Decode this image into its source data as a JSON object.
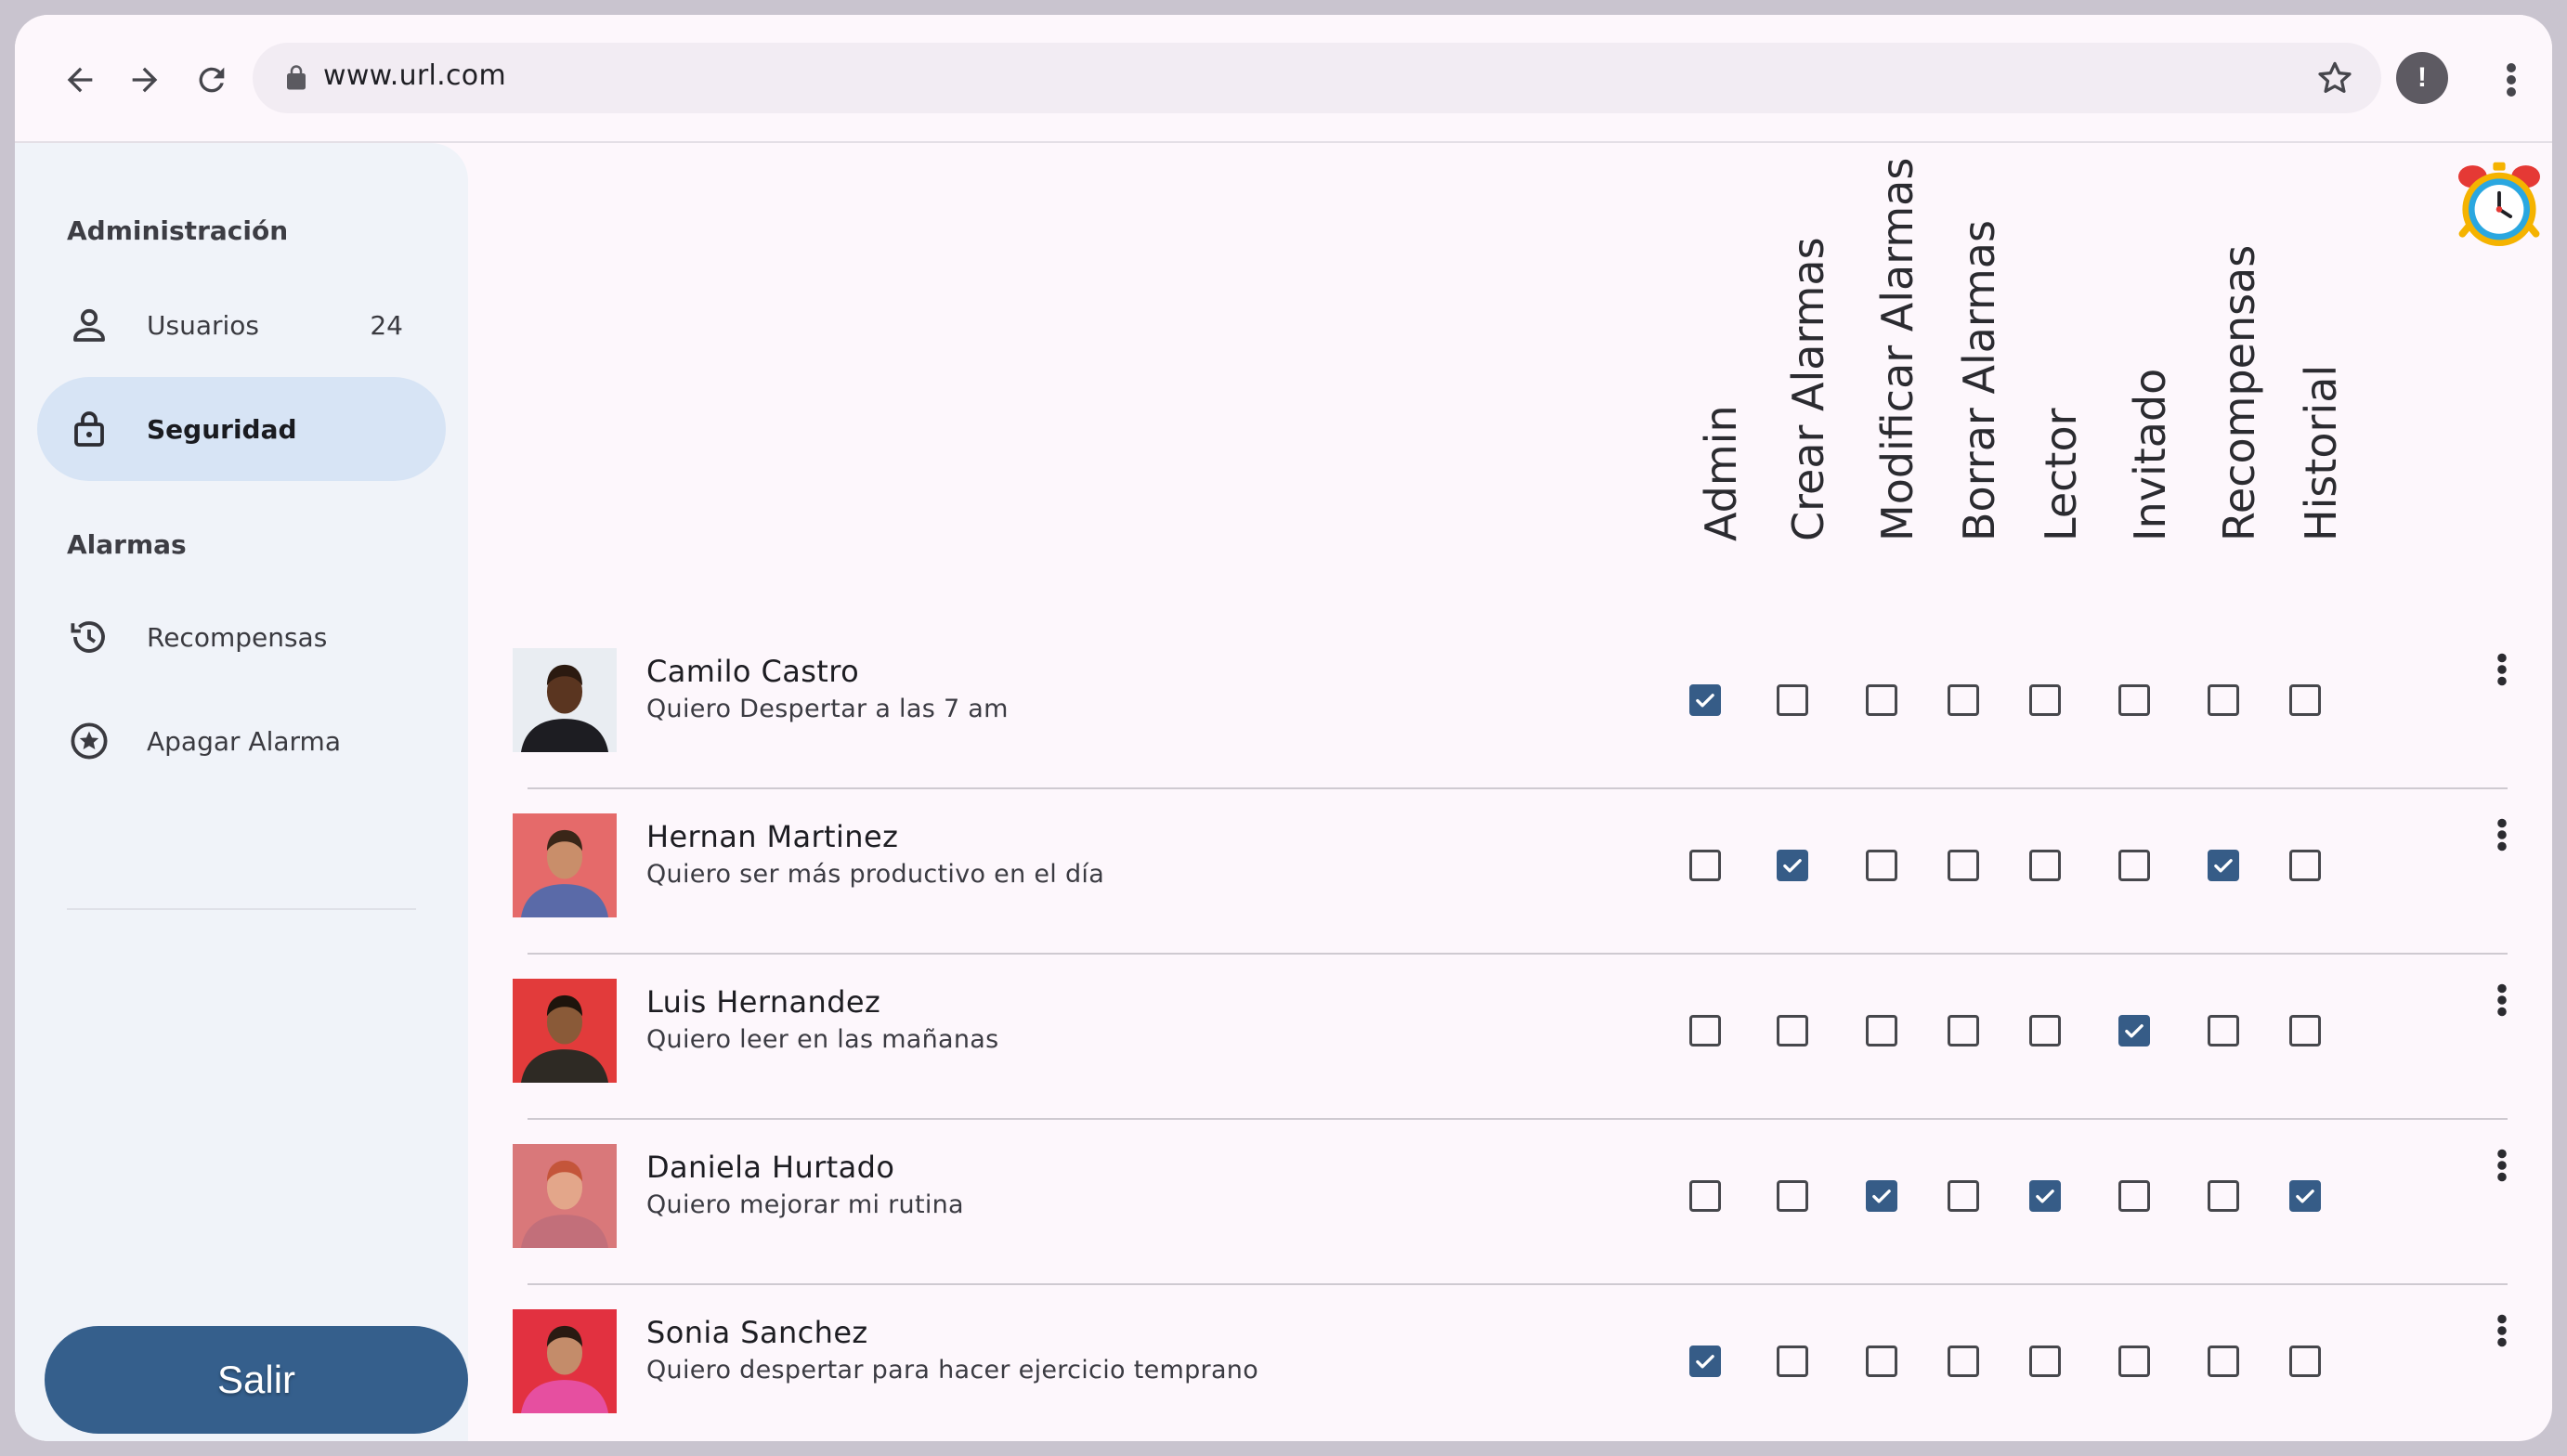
{
  "browser": {
    "url": "www.url.com",
    "profile_initial": "!"
  },
  "sidebar": {
    "section_admin": "Administración",
    "section_alarms": "Alarmas",
    "items": [
      {
        "label": "Usuarios",
        "badge": "24",
        "icon": "person-icon"
      },
      {
        "label": "Seguridad",
        "icon": "lock-icon",
        "active": true
      },
      {
        "label": "Recompensas",
        "icon": "history-icon"
      },
      {
        "label": "Apagar Alarma",
        "icon": "star-circle-icon"
      }
    ],
    "logout_label": "Salir"
  },
  "permissions": {
    "columns": [
      "Admin",
      "Crear Alarmas",
      "Modificar Alarmas",
      "Borrar Alarmas",
      "Lector",
      "Invitado",
      "Recompensas",
      "Historial"
    ],
    "users": [
      {
        "name": "Camilo Castro",
        "description": "Quiero Despertar a las 7 am",
        "checks": [
          true,
          false,
          false,
          false,
          false,
          false,
          false,
          false
        ]
      },
      {
        "name": "Hernan Martinez",
        "description": "Quiero ser más productivo en el día",
        "checks": [
          false,
          true,
          false,
          false,
          false,
          false,
          true,
          false
        ]
      },
      {
        "name": "Luis Hernandez",
        "description": "Quiero leer en las mañanas",
        "checks": [
          false,
          false,
          false,
          false,
          false,
          true,
          false,
          false
        ]
      },
      {
        "name": "Daniela Hurtado",
        "description": "Quiero mejorar mi rutina",
        "checks": [
          false,
          false,
          true,
          false,
          true,
          false,
          false,
          true
        ]
      },
      {
        "name": "Sonia Sanchez",
        "description": "Quiero despertar para hacer ejercicio temprano",
        "checks": [
          true,
          false,
          false,
          false,
          false,
          false,
          false,
          false
        ]
      }
    ]
  },
  "colors": {
    "accent": "#365c87",
    "logout": "#355f8c",
    "active_nav": "#d7e4f5",
    "sidebar_bg": "#f0f3f9",
    "page_bg": "#fdf7fc"
  }
}
